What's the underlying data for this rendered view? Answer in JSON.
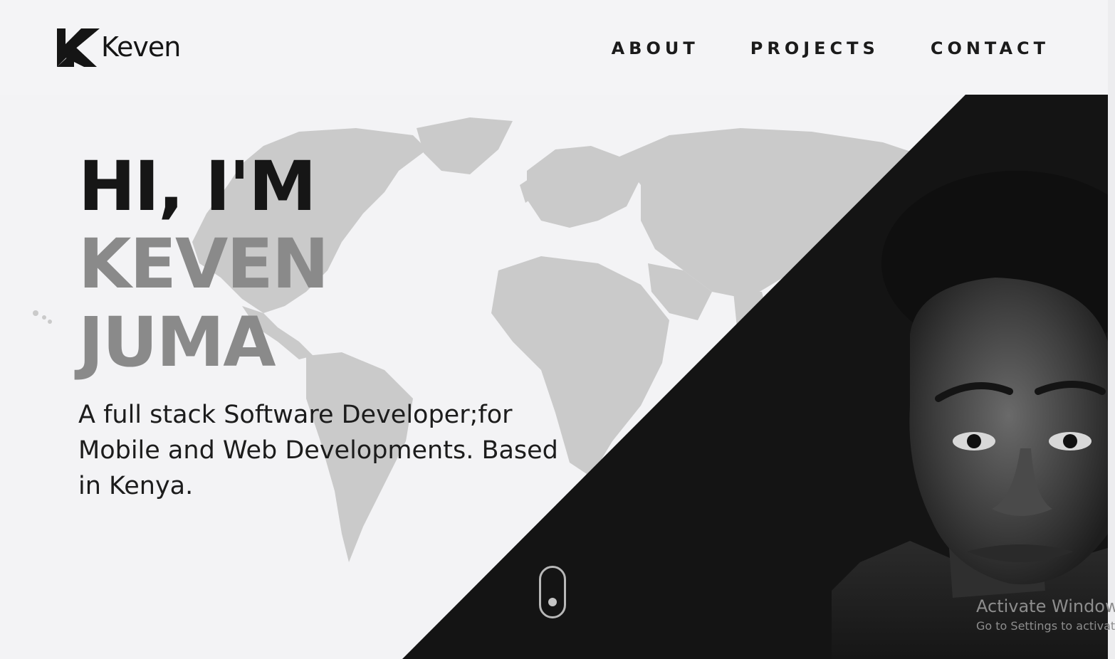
{
  "logo": {
    "text": "Keven"
  },
  "nav": {
    "items": [
      "ABOUT",
      "PROJECTS",
      "CONTACT"
    ]
  },
  "hero": {
    "line1": "HI, I'M",
    "line2": "KEVEN",
    "line3": "JUMA",
    "tagline": "A full stack Software Developer;for Mobile and Web Developments. Based in Kenya."
  },
  "watermark": {
    "title": "Activate Windows",
    "subtitle": "Go to Settings to activate"
  },
  "icons": [
    "keven-logo-icon",
    "world-map",
    "scroll-mouse-icon",
    "portrait-photo"
  ],
  "colors": {
    "background": "#f3f3f5",
    "dark_panel": "#141414",
    "text_dark": "#161616",
    "text_grey": "#8a8a8a",
    "map": "#c7c7c7"
  }
}
